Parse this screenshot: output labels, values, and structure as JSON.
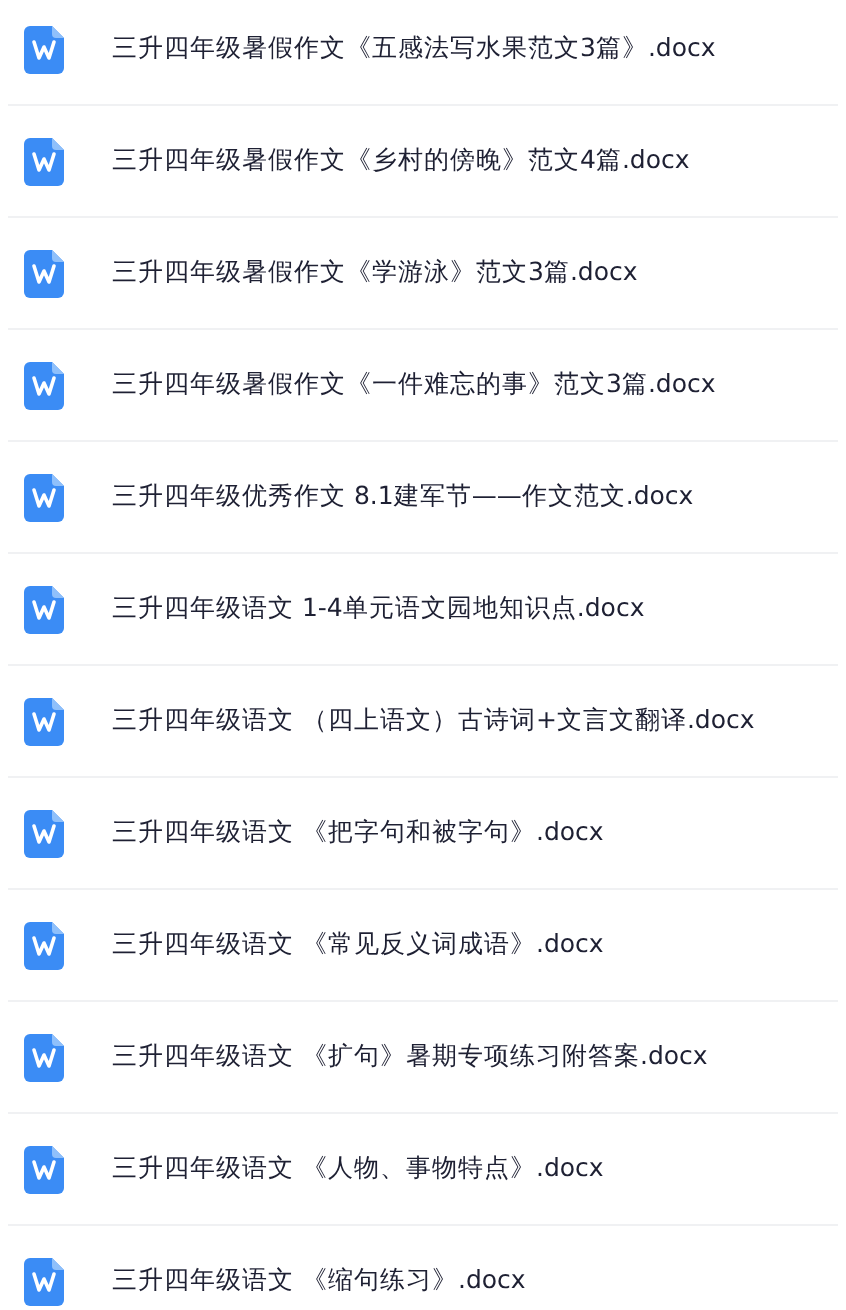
{
  "files": [
    {
      "name": "三升四年级暑假作文《五感法写水果范文3篇》.docx"
    },
    {
      "name": "三升四年级暑假作文《乡村的傍晚》范文4篇.docx"
    },
    {
      "name": "三升四年级暑假作文《学游泳》范文3篇.docx"
    },
    {
      "name": "三升四年级暑假作文《一件难忘的事》范文3篇.docx"
    },
    {
      "name": "三升四年级优秀作文 8.1建军节——作文范文.docx"
    },
    {
      "name": "三升四年级语文 1-4单元语文园地知识点.docx"
    },
    {
      "name": "三升四年级语文 （四上语文）古诗词+文言文翻译.docx"
    },
    {
      "name": "三升四年级语文 《把字句和被字句》.docx"
    },
    {
      "name": "三升四年级语文 《常见反义词成语》.docx"
    },
    {
      "name": "三升四年级语文 《扩句》暑期专项练习附答案.docx"
    },
    {
      "name": "三升四年级语文 《人物、事物特点》.docx"
    },
    {
      "name": "三升四年级语文 《缩句练习》.docx"
    }
  ]
}
